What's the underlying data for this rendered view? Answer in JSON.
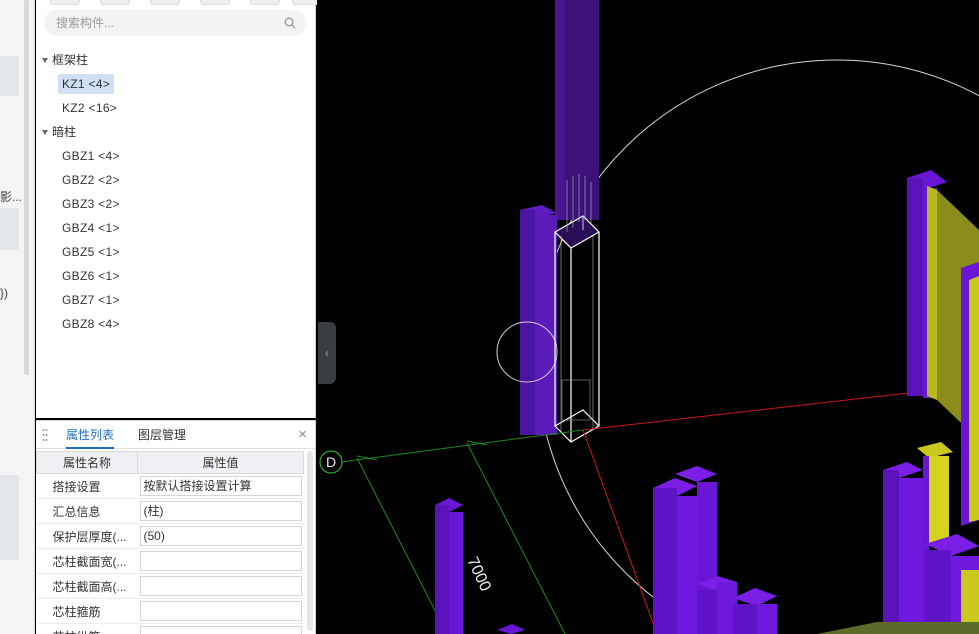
{
  "left_strip": {
    "cut_text_1": "影...",
    "cut_text_2": "})"
  },
  "search": {
    "placeholder": "搜索构件..."
  },
  "tree": {
    "groups": [
      {
        "label": "框架柱",
        "items": [
          "KZ1 <4>",
          "KZ2 <16>"
        ]
      },
      {
        "label": "暗柱",
        "items": [
          "GBZ1 <4>",
          "GBZ2 <2>",
          "GBZ3 <2>",
          "GBZ4 <1>",
          "GBZ5 <1>",
          "GBZ6 <1>",
          "GBZ7 <1>",
          "GBZ8 <4>"
        ]
      }
    ],
    "selected": "KZ1 <4>"
  },
  "properties": {
    "tabs": [
      "属性列表",
      "图层管理"
    ],
    "active_tab": "属性列表",
    "columns": [
      "属性名称",
      "属性值"
    ],
    "rows": [
      {
        "name": "搭接设置",
        "value": "按默认搭接设置计算"
      },
      {
        "name": "汇总信息",
        "value": "(柱)"
      },
      {
        "name": "保护层厚度(...",
        "value": "(50)"
      },
      {
        "name": "芯柱截面宽(...",
        "value": ""
      },
      {
        "name": "芯柱截面高(...",
        "value": ""
      },
      {
        "name": "芯柱箍筋",
        "value": ""
      },
      {
        "name": "芯柱纵筋",
        "value": ""
      }
    ]
  },
  "viewport": {
    "axis_label": "D",
    "dimension_label": "7000",
    "collapse_glyph": "‹"
  },
  "colors": {
    "selected_bg": "#cfe0f5",
    "active_tab": "#1e6fc8",
    "column_purple": "#6a16d6",
    "wall_yellow": "#c8c81e"
  }
}
